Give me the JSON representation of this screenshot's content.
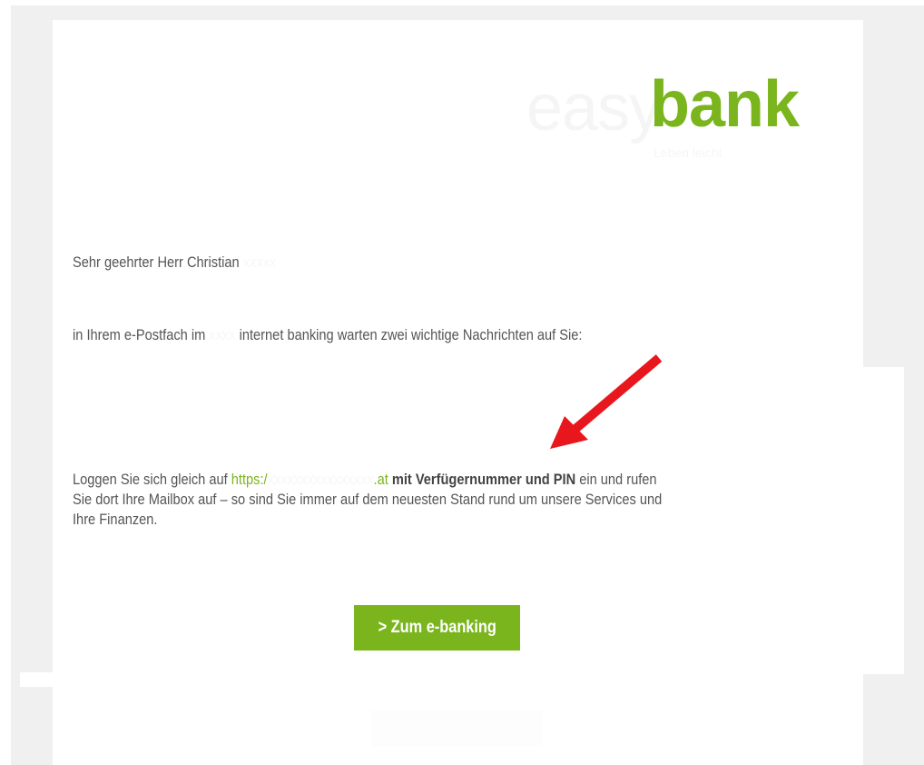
{
  "logo": {
    "watermark": "easy",
    "brand": "bank",
    "tagline": "Leben leicht"
  },
  "email": {
    "greeting": "Sehr geehrter Herr Christian",
    "greeting_redacted": "xxxxx",
    "intro_before": "in Ihrem e-Postfach im ",
    "intro_redacted": "xxxx",
    "intro_after": " internet banking warten zwei wichtige Nachrichten auf Sie:",
    "body_line1_before": "Loggen Sie sich gleich auf ",
    "link_start": "https:/",
    "link_redacted": "xxxxxxxxxxxxxxxx",
    "link_end": ".at",
    "body_line1_strong": " mit Verfügernummer und PIN",
    "body_line1_after": " ein und rufen",
    "body_line2": "Sie dort Ihre Mailbox auf – so sind Sie immer auf dem neuesten Stand rund um unsere Services und",
    "body_line3": "Ihre Finanzen."
  },
  "cta": {
    "label": "> Zum e-banking"
  },
  "colors": {
    "brand_green": "#7ab51d",
    "arrow_red": "#e8171d"
  }
}
